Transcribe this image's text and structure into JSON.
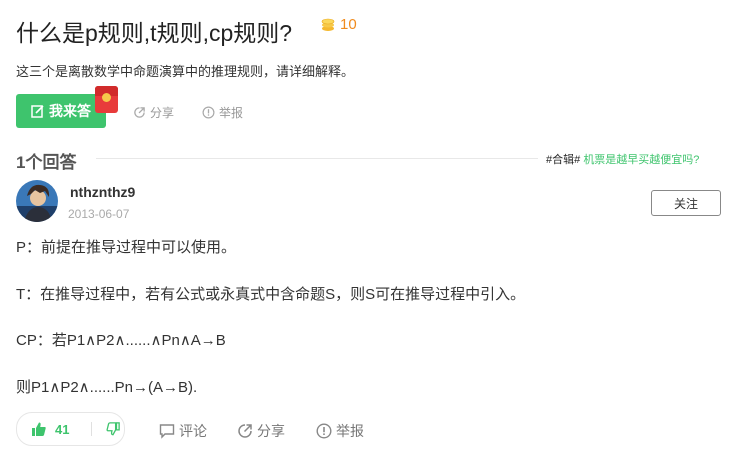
{
  "question": {
    "title": "什么是p规则,t规则,cp规则?",
    "reward": "10",
    "description": "这三个是离散数学中命题演算中的推理规则，请详细解释。"
  },
  "question_actions": {
    "answer_label": "我来答",
    "share_label": "分享",
    "report_label": "举报"
  },
  "answers": {
    "count_label": "1个回答",
    "topic_tag": "#合辑#",
    "topic_link": "机票是越早买越便宜吗?"
  },
  "answer": {
    "username": "nthznthz9",
    "date": "2013-06-07",
    "follow_label": "关注",
    "lines": [
      "P：前提在推导过程中可以使用。",
      "T：在推导过程中，若有公式或永真式中含命题S，则S可在推导过程中引入。",
      "CP：若P1∧P2∧......∧Pn∧A→B",
      "则P1∧P2∧......Pn→(A→B)."
    ],
    "votes": "41",
    "comment_label": "评论",
    "share_label": "分享",
    "report_label": "举报"
  },
  "colors": {
    "accent_green": "#3ec46d",
    "reward_orange": "#f08b1d"
  }
}
